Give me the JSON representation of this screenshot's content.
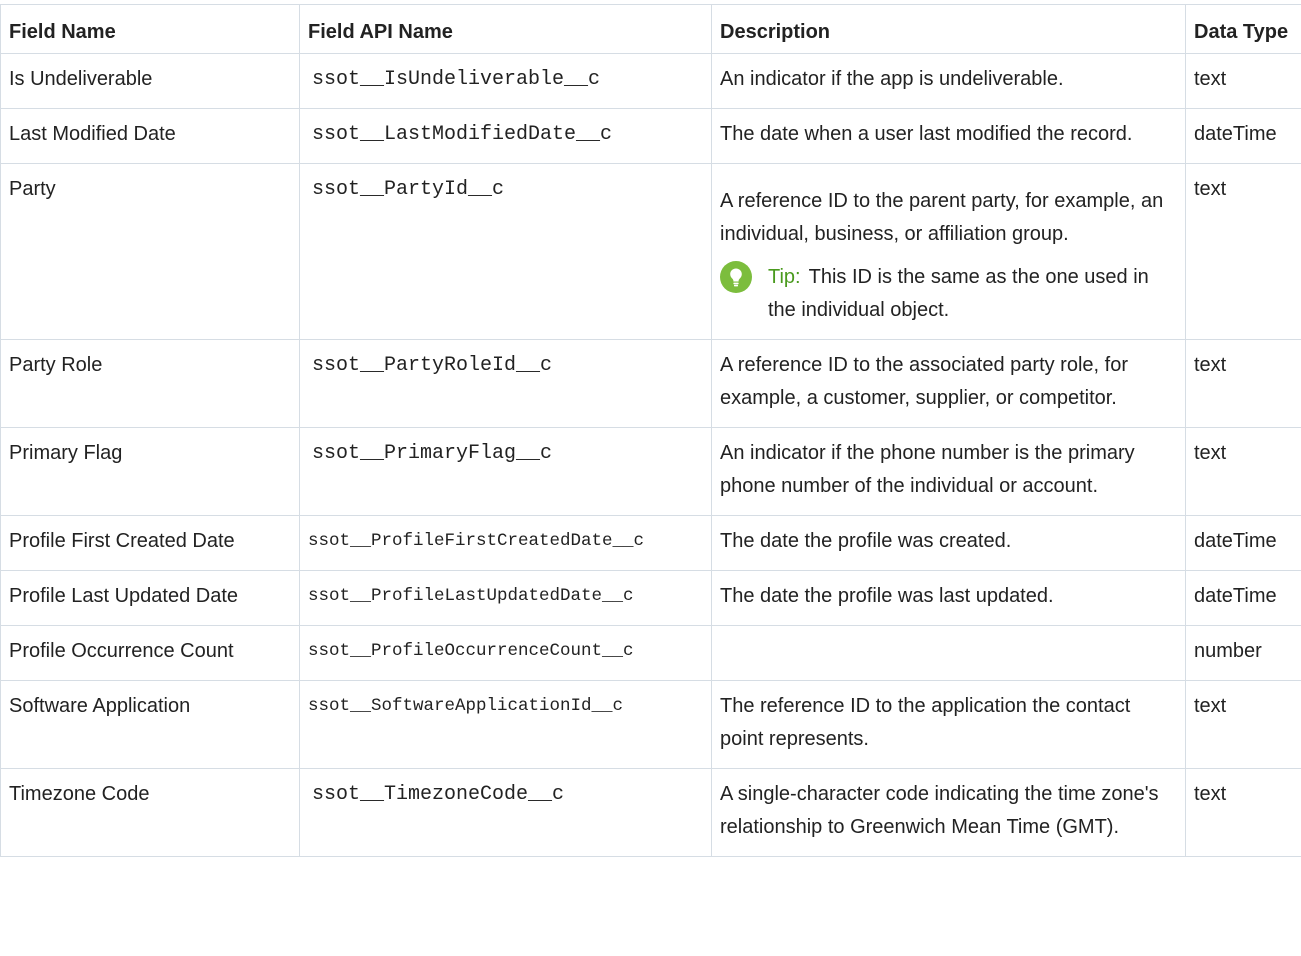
{
  "table": {
    "headers": {
      "field_name": "Field Name",
      "field_api_name": "Field API Name",
      "description": "Description",
      "data_type": "Data Type"
    },
    "rows": [
      {
        "field_name": "Is Undeliverable",
        "api_name": "ssot__IsUndeliverable__c",
        "description": "An indicator if the app is undeliverable.",
        "data_type": "text"
      },
      {
        "field_name": "Last Modified Date",
        "api_name": "ssot__LastModifiedDate__c",
        "description": "The date when a user last modified the record.",
        "data_type": "dateTime"
      },
      {
        "field_name": "Party",
        "api_name": "ssot__PartyId__c",
        "description": "A reference ID to the parent party, for example, an individual, business, or affiliation group.",
        "tip_label": "Tip:",
        "tip_text": "This ID is the same as the one used in the individual object.",
        "data_type": "text"
      },
      {
        "field_name": "Party Role",
        "api_name": "ssot__PartyRoleId__c",
        "description": "A reference ID to the associated party role, for example, a customer, supplier, or competitor.",
        "data_type": "text"
      },
      {
        "field_name": "Primary Flag",
        "api_name": "ssot__PrimaryFlag__c",
        "description": "An indicator if the phone number is the primary phone number of the individual or account.",
        "data_type": "text"
      },
      {
        "field_name": "Profile First Created Date",
        "api_name": "ssot__ProfileFirstCreatedDate__c",
        "description": "The date the profile was created.",
        "data_type": "dateTime"
      },
      {
        "field_name": "Profile Last Updated Date",
        "api_name": "ssot__ProfileLastUpdatedDate__c",
        "description": "The date the profile was last updated.",
        "data_type": "dateTime"
      },
      {
        "field_name": "Profile Occurrence Count",
        "api_name": "ssot__ProfileOccurrenceCount__c",
        "description": "",
        "data_type": "number"
      },
      {
        "field_name": "Software Application",
        "api_name": "ssot__SoftwareApplicationId__c",
        "description": "The reference ID to the application the contact point represents.",
        "data_type": "text"
      },
      {
        "field_name": "Timezone Code",
        "api_name": "ssot__TimezoneCode__c",
        "description": "A single-character code indicating the time zone's relationship to Greenwich Mean Time (GMT).",
        "data_type": "text"
      }
    ]
  },
  "icons": {
    "tip": "lightbulb-icon"
  },
  "colors": {
    "tip_icon": "#7cbd3d",
    "tip_label": "#4a9a1e",
    "border": "#d6dde4"
  }
}
